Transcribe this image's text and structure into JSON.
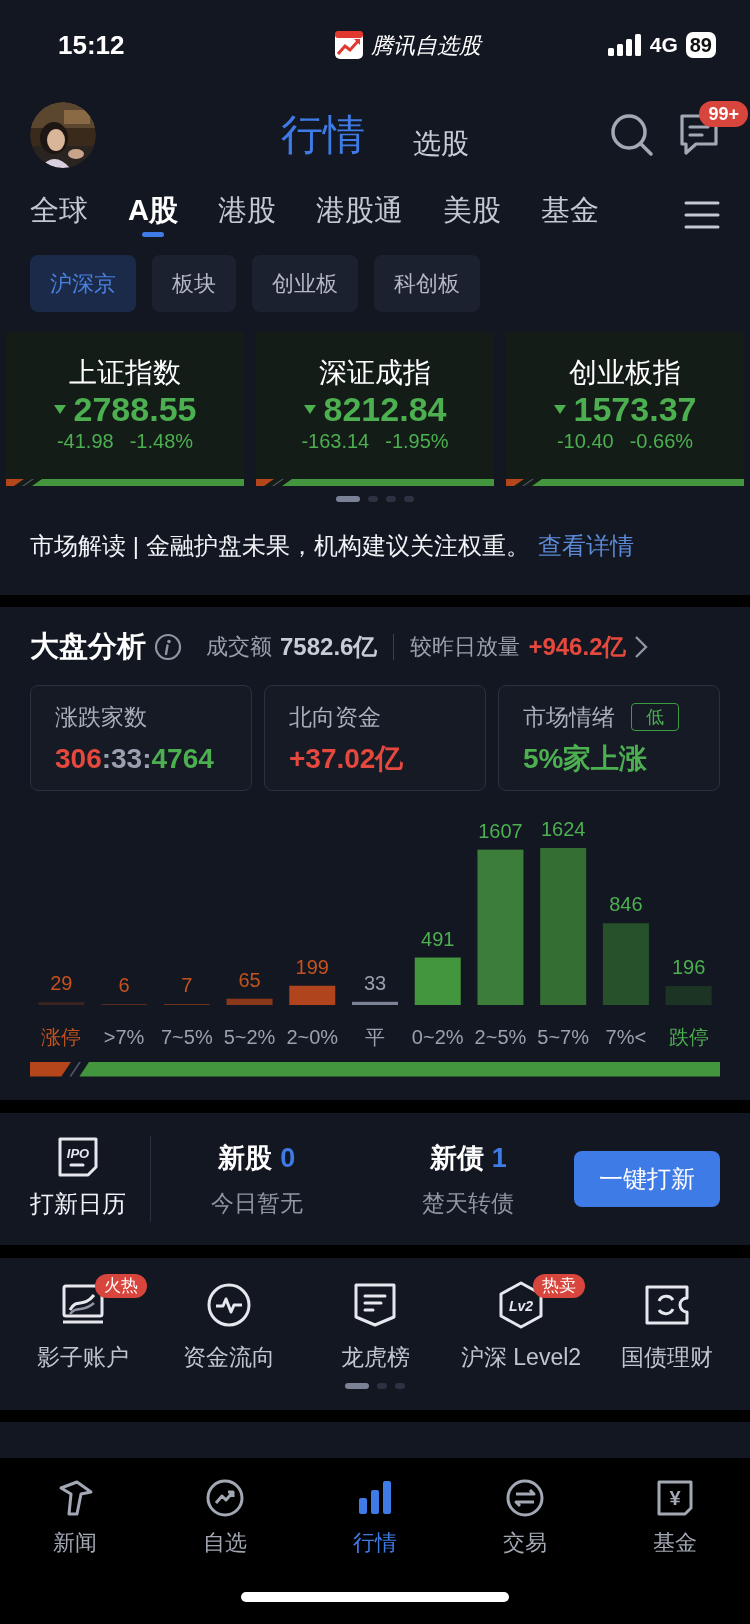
{
  "status_bar": {
    "time": "15:12",
    "app": "腾讯自选股",
    "network": "4G",
    "battery": "89"
  },
  "header": {
    "tabs": [
      {
        "label": "行情",
        "selected": true
      },
      {
        "label": "选股",
        "selected": false
      }
    ],
    "message_badge": "99+"
  },
  "market_tabs": [
    {
      "label": "全球",
      "selected": false
    },
    {
      "label": "A股",
      "selected": true
    },
    {
      "label": "港股",
      "selected": false
    },
    {
      "label": "港股通",
      "selected": false
    },
    {
      "label": "美股",
      "selected": false
    },
    {
      "label": "基金",
      "selected": false
    }
  ],
  "sub_tabs": [
    {
      "label": "沪深京",
      "selected": true
    },
    {
      "label": "板块",
      "selected": false
    },
    {
      "label": "创业板",
      "selected": false
    },
    {
      "label": "科创板",
      "selected": false
    }
  ],
  "indices": [
    {
      "name": "上证指数",
      "kind": "down",
      "price": "2788.55",
      "change": "-41.98",
      "change_pct": "-1.48%"
    },
    {
      "name": "深证成指",
      "kind": "down",
      "price": "8212.84",
      "change": "-163.14",
      "change_pct": "-1.95%"
    },
    {
      "name": "创业板指",
      "kind": "down",
      "price": "1573.37",
      "change": "-10.40",
      "change_pct": "-0.66%"
    }
  ],
  "carousel_pages": [
    {
      "selected": true
    },
    {
      "selected": false
    },
    {
      "selected": false
    },
    {
      "selected": false
    }
  ],
  "commentary": {
    "text": "市场解读 | 金融护盘未果，机构建议关注权重。",
    "link": "查看详情"
  },
  "analysis": {
    "title": "大盘分析",
    "turnover_label": "成交额",
    "turnover": "7582.6亿",
    "volume_label": "较昨日放量",
    "volume_change": "+946.2亿",
    "stats": [
      {
        "kind": "ratio",
        "label": "涨跌家数",
        "parts": [
          {
            "text": "306",
            "kind": "up"
          },
          {
            "text": ":33:",
            "kind": "flat"
          },
          {
            "text": "4764",
            "kind": "down"
          }
        ]
      },
      {
        "kind": "value",
        "label": "北向资金",
        "parts": [
          {
            "text": "+37.02亿",
            "kind": "up"
          }
        ]
      },
      {
        "kind": "sentiment",
        "label": "市场情绪",
        "tag": "低",
        "parts": [
          {
            "text": "5%家上涨",
            "kind": "down"
          }
        ]
      }
    ],
    "chart_data": {
      "type": "bar",
      "categories": [
        "涨停",
        ">7%",
        "7~5%",
        "5~2%",
        "2~0%",
        "平",
        "0~2%",
        "2~5%",
        "5~7%",
        "7%<",
        "跌停"
      ],
      "values": [
        29,
        6,
        7,
        65,
        199,
        33,
        491,
        1607,
        1624,
        846,
        196
      ],
      "data_labels": true
    }
  },
  "ipo": {
    "calendar_label": "打新日历",
    "icon_text": "IPO",
    "items": [
      {
        "label": "新股",
        "count": "0",
        "note": "今日暂无"
      },
      {
        "label": "新债",
        "count": "1",
        "note": "楚天转债"
      }
    ],
    "button": "一键打新"
  },
  "shortcuts": [
    {
      "kind": "screen",
      "label": "影子账户",
      "badge": "火热"
    },
    {
      "kind": "pulse",
      "label": "资金流向"
    },
    {
      "kind": "list",
      "label": "龙虎榜"
    },
    {
      "kind": "level2",
      "label": "沪深 Level2",
      "icon_text": "Lv2",
      "badge": "热卖"
    },
    {
      "kind": "ticket",
      "label": "国债理财"
    }
  ],
  "shortcut_pages": [
    {
      "selected": true
    },
    {
      "selected": false
    },
    {
      "selected": false
    }
  ],
  "bottom_nav": [
    {
      "kind": "news",
      "label": "新闻",
      "selected": false
    },
    {
      "kind": "watchlist",
      "label": "自选",
      "selected": false
    },
    {
      "kind": "market",
      "label": "行情",
      "selected": true
    },
    {
      "kind": "trade",
      "label": "交易",
      "selected": false
    },
    {
      "kind": "fund",
      "label": "基金",
      "icon_text": "¥",
      "selected": false
    }
  ]
}
